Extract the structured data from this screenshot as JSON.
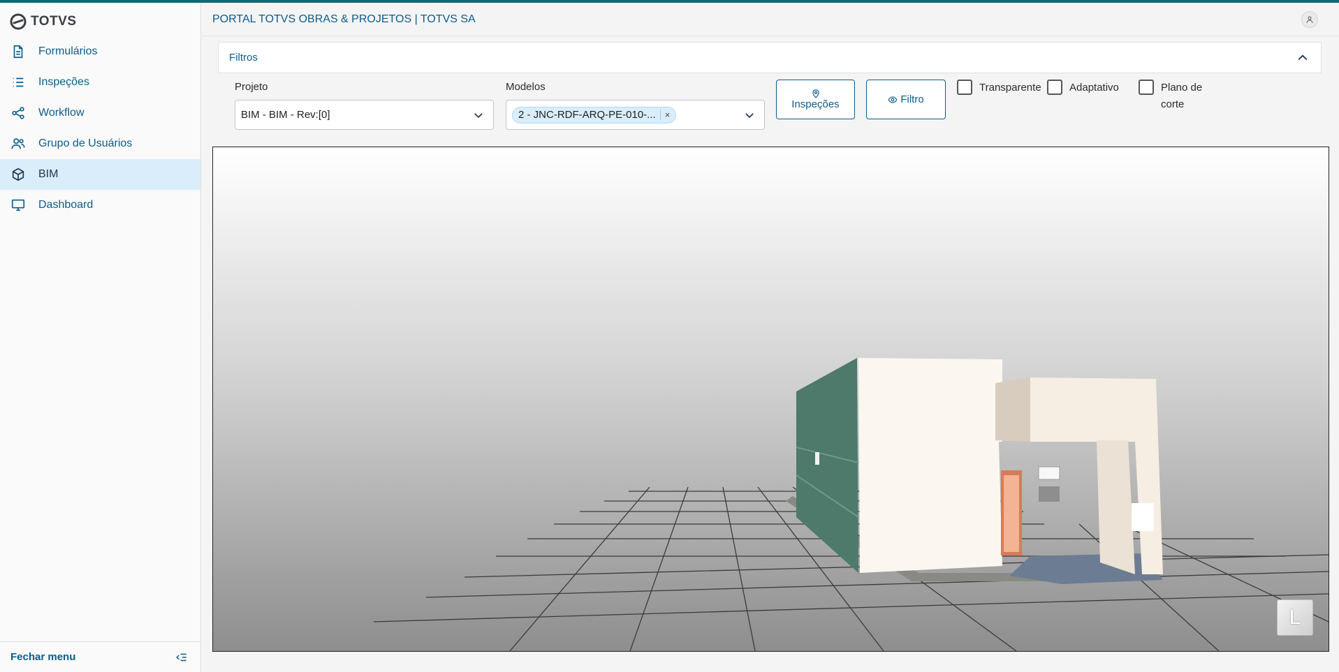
{
  "app": {
    "logo_text": "TOTVS",
    "header_title": "PORTAL TOTVS OBRAS & PROJETOS | TOTVS SA",
    "accent_color": "#0b6b73"
  },
  "sidebar": {
    "items": [
      {
        "label": "Formulários",
        "icon": "document-icon",
        "active": false
      },
      {
        "label": "Inspeções",
        "icon": "list-icon",
        "active": false
      },
      {
        "label": "Workflow",
        "icon": "share-icon",
        "active": false
      },
      {
        "label": "Grupo de Usuários",
        "icon": "users-icon",
        "active": false
      },
      {
        "label": "BIM",
        "icon": "cube-icon",
        "active": true
      },
      {
        "label": "Dashboard",
        "icon": "monitor-icon",
        "active": false
      }
    ],
    "footer_label": "Fechar menu"
  },
  "filters": {
    "title": "Filtros",
    "projeto_label": "Projeto",
    "projeto_value": "BIM - BIM - Rev:[0]",
    "modelos_label": "Modelos",
    "modelos_chip": "2 - JNC-RDF-ARQ-PE-010-...",
    "chip_close": "×",
    "inspecoes_button": "Inspeções",
    "filtro_button": "Filtro",
    "checkboxes": [
      {
        "label": "Transparente",
        "checked": false
      },
      {
        "label": "Adaptativo",
        "checked": false
      },
      {
        "label_line1": "Plano de",
        "label_line2": "corte",
        "checked": false
      }
    ]
  },
  "viewer": {
    "view_cube_label": "L"
  }
}
